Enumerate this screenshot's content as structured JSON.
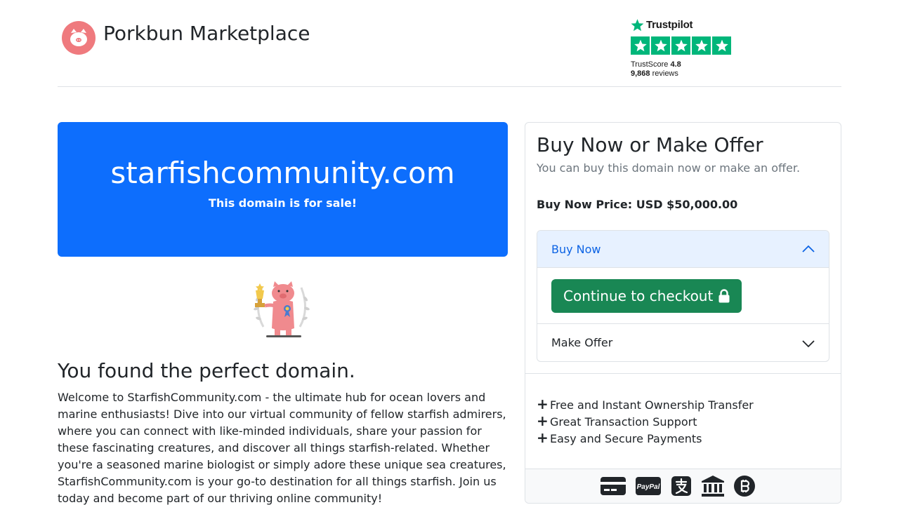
{
  "header": {
    "brand": "Porkbun Marketplace",
    "logo_icon": "pig-logo-icon"
  },
  "trustpilot": {
    "name": "Trustpilot",
    "score_label": "TrustScore",
    "score": "4.8",
    "reviews_count": "9,868",
    "reviews_label": "reviews",
    "stars": 5,
    "color": "#00b67a"
  },
  "hero": {
    "domain": "starfishcommunity.com",
    "subtitle": "This domain is for sale!",
    "color": "#0d6efd"
  },
  "main": {
    "title": "You found the perfect domain.",
    "description": "Welcome to StarfishCommunity.com - the ultimate hub for ocean lovers and marine enthusiasts! Dive into our virtual community of fellow starfish admirers, where you can connect with like-minded individuals, share your passion for these fascinating creatures, and discover all things starfish-related. Whether you're a seasoned marine biologist or simply adore these unique sea creatures, StarfishCommunity.com is your go-to destination for all things starfish. Join us today and become part of our thriving online community!"
  },
  "offer": {
    "title": "Buy Now or Make Offer",
    "subtitle": "You can buy this domain now or make an offer.",
    "price_label": "Buy Now Price: USD $50,000.00",
    "buy_now_label": "Buy Now",
    "checkout_label": "Continue to checkout",
    "make_offer_label": "Make Offer",
    "features": [
      "Free and Instant Ownership Transfer",
      "Great Transaction Support",
      "Easy and Secure Payments"
    ],
    "payment_icons": [
      "credit-card-icon",
      "paypal-icon",
      "alipay-icon",
      "bank-icon",
      "bitcoin-icon"
    ],
    "paypal_text": "PayPal",
    "accent": "#0c63e4",
    "checkout_color": "#198754"
  }
}
